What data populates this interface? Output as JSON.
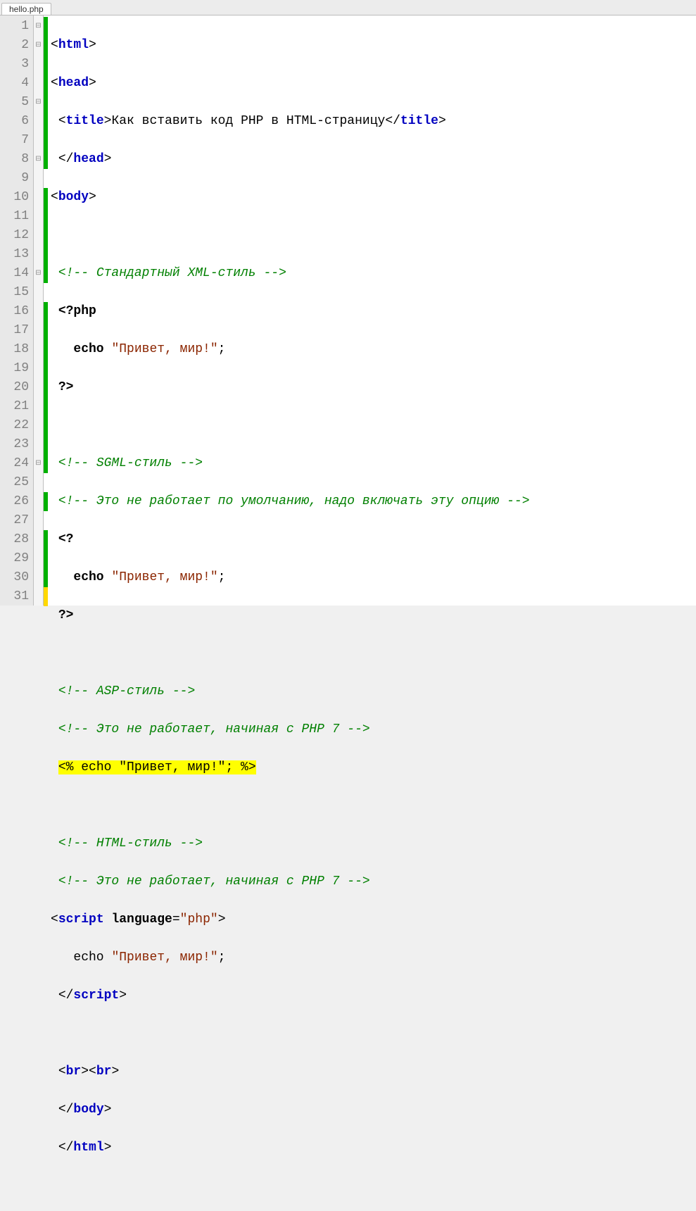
{
  "tab": {
    "filename": "hello.php"
  },
  "lines": [
    {
      "n": 1,
      "fold": "⊟",
      "marker": "green"
    },
    {
      "n": 2,
      "fold": "⊟",
      "marker": "green"
    },
    {
      "n": 3,
      "fold": "",
      "marker": "green"
    },
    {
      "n": 4,
      "fold": "",
      "marker": "green"
    },
    {
      "n": 5,
      "fold": "⊟",
      "marker": "green"
    },
    {
      "n": 6,
      "fold": "",
      "marker": "green"
    },
    {
      "n": 7,
      "fold": "",
      "marker": "green"
    },
    {
      "n": 8,
      "fold": "⊟",
      "marker": "green"
    },
    {
      "n": 9,
      "fold": "",
      "marker": ""
    },
    {
      "n": 10,
      "fold": "",
      "marker": "green"
    },
    {
      "n": 11,
      "fold": "",
      "marker": "green"
    },
    {
      "n": 12,
      "fold": "",
      "marker": "green"
    },
    {
      "n": 13,
      "fold": "",
      "marker": "green"
    },
    {
      "n": 14,
      "fold": "⊟",
      "marker": "green"
    },
    {
      "n": 15,
      "fold": "",
      "marker": ""
    },
    {
      "n": 16,
      "fold": "",
      "marker": "green"
    },
    {
      "n": 17,
      "fold": "",
      "marker": "green"
    },
    {
      "n": 18,
      "fold": "",
      "marker": "green"
    },
    {
      "n": 19,
      "fold": "",
      "marker": "green"
    },
    {
      "n": 20,
      "fold": "",
      "marker": "green"
    },
    {
      "n": 21,
      "fold": "",
      "marker": "green"
    },
    {
      "n": 22,
      "fold": "",
      "marker": "green"
    },
    {
      "n": 23,
      "fold": "",
      "marker": "green"
    },
    {
      "n": 24,
      "fold": "⊟",
      "marker": "green"
    },
    {
      "n": 25,
      "fold": "",
      "marker": ""
    },
    {
      "n": 26,
      "fold": "",
      "marker": "green"
    },
    {
      "n": 27,
      "fold": "",
      "marker": ""
    },
    {
      "n": 28,
      "fold": "",
      "marker": "green"
    },
    {
      "n": 29,
      "fold": "",
      "marker": "green"
    },
    {
      "n": 30,
      "fold": "",
      "marker": "green"
    },
    {
      "n": 31,
      "fold": "",
      "marker": "yellow"
    }
  ],
  "code": {
    "l1": {
      "tag_open": "html"
    },
    "l2": {
      "tag_open": "head"
    },
    "l3": {
      "tag_open": "title",
      "text": "Как вставить код PHP в HTML-страницу",
      "tag_close": "title"
    },
    "l4": {
      "tag_close": "head"
    },
    "l5": {
      "tag_open": "body"
    },
    "l7": {
      "comment": "<!-- Стандартный XML-стиль -->"
    },
    "l8": {
      "php_open": "<?php"
    },
    "l9": {
      "kw": "echo",
      "str": "\"Привет, мир!\"",
      "semi": ";"
    },
    "l10": {
      "php_close": "?>"
    },
    "l12": {
      "comment": "<!-- SGML-стиль -->"
    },
    "l13": {
      "comment": "<!-- Это не работает по умолчанию, надо включать эту опцию -->"
    },
    "l14": {
      "php_open": "<?"
    },
    "l15": {
      "kw": "echo",
      "str": "\"Привет, мир!\"",
      "semi": ";"
    },
    "l16": {
      "php_close": "?>"
    },
    "l18": {
      "comment": "<!-- ASP-стиль -->"
    },
    "l19": {
      "comment": "<!-- Это не работает, начиная с PHP 7 -->"
    },
    "l20": {
      "asp": "<% echo \"Привет, мир!\"; %>"
    },
    "l22": {
      "comment": "<!-- HTML-стиль -->"
    },
    "l23": {
      "comment": "<!-- Это не работает, начиная с PHP 7 -->"
    },
    "l24": {
      "tag_open": "script",
      "attr": "language",
      "val": "\"php\""
    },
    "l25": {
      "kw": "echo",
      "str": "\"Привет, мир!\"",
      "semi": ";"
    },
    "l26": {
      "tag_close": "script"
    },
    "l28": {
      "tag1": "br",
      "tag2": "br"
    },
    "l29": {
      "tag_close": "body"
    },
    "l30": {
      "tag_close": "html"
    }
  }
}
